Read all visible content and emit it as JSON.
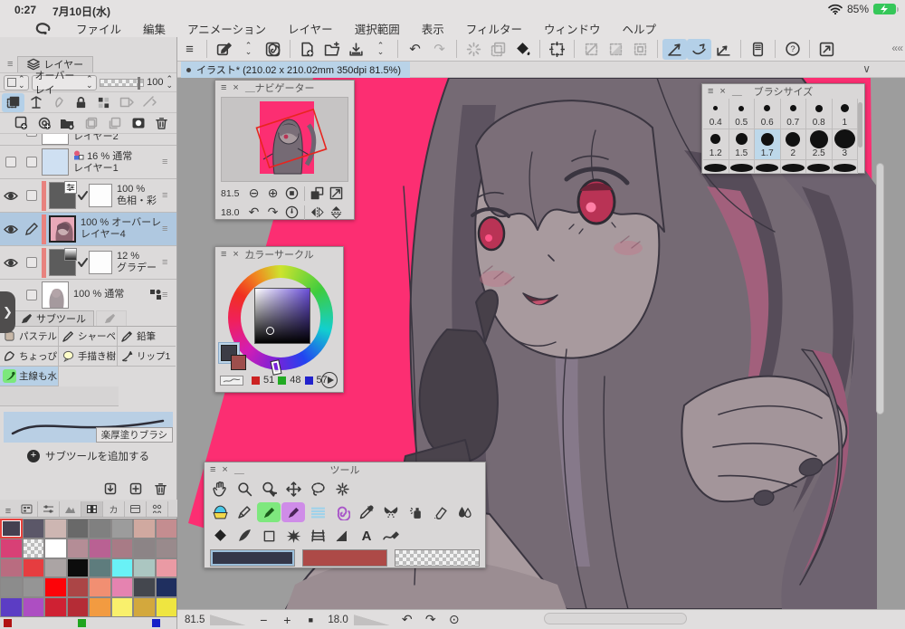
{
  "colors": {
    "accent_pink": "#fc2e72",
    "chrome": "#e4e2e2",
    "panel": "#d9d7d7",
    "highlight_blue": "#b9d3e8",
    "selected_row": "#afc8e0"
  },
  "status_bar": {
    "time": "0:27",
    "date": "7月10日(水)",
    "battery_percent": "85%"
  },
  "menu_bar": {
    "items": [
      "ファイル",
      "編集",
      "アニメーション",
      "レイヤー",
      "選択範囲",
      "表示",
      "フィルター",
      "ウィンドウ",
      "ヘルプ"
    ]
  },
  "document_tab": {
    "title": "イラスト* (210.02 x 210.02mm 350dpi 81.5%)"
  },
  "layers_panel": {
    "title": "レイヤー",
    "blend_mode": "オーバーレイ",
    "opacity_value": "100",
    "layers": [
      {
        "name": "レイヤー2"
      },
      {
        "opacity": "16 %",
        "mode": "通常",
        "name": "レイヤー1"
      },
      {
        "opacity": "100 %",
        "mode": "色相・彩"
      },
      {
        "opacity": "100 %",
        "mode": "オーバーレイ",
        "name": "レイヤー4"
      },
      {
        "opacity": "12 %",
        "name": "グラデー"
      },
      {
        "opacity": "100 %",
        "mode": "通常"
      }
    ]
  },
  "subtool_panel": {
    "title": "サブツール",
    "items": [
      "パステル",
      "シャーペ",
      "鉛筆",
      "ちょっぴ",
      "手描き樹",
      "リップ1",
      "主線も水"
    ],
    "preview_label": "楽厚塗りブラシ",
    "add_button": "サブツールを追加する"
  },
  "navigator": {
    "title": "ナビゲーター",
    "zoom": "81.5",
    "rotation": "18.0"
  },
  "brush_size_panel": {
    "title": "ブラシサイズ",
    "sizes": [
      "0.4",
      "0.5",
      "0.6",
      "0.7",
      "0.8",
      "1",
      "1.2",
      "1.5",
      "1.7",
      "2",
      "2.5",
      "3"
    ],
    "selected": "1.7"
  },
  "color_circle": {
    "title": "カラーサークル",
    "r": "51",
    "g": "48",
    "b": "57"
  },
  "tool_panel": {
    "title": "ツール"
  },
  "canvas_bar": {
    "zoom": "81.5",
    "rotation": "18.0"
  },
  "swatches": {
    "tab_label_ka": "カ",
    "colors": [
      "#454050",
      "#5b5768",
      "#cdb6b2",
      "#696969",
      "#808080",
      "#9c9c9c",
      "#d0a9a0",
      "#c48d90",
      "#d84076",
      "checker",
      "#ffffff",
      "#b48d96",
      "#b96193",
      "#a87b86",
      "#8c8486",
      "#998a8c",
      "#b96c80",
      "#e63d40",
      "#aba4a4",
      "#0c0c0c",
      "#5e7c7d",
      "#69f1f6",
      "#abc6c1",
      "#ea9aa4",
      "#8c8c8c",
      "#959595",
      "#fd0308",
      "#ab4546",
      "#f18f72",
      "#e583b0",
      "#44474e",
      "#1f2f5f",
      "#5c3dc4",
      "#ad4ec2",
      "#cf2133",
      "#b52c36",
      "#f29b41",
      "#f9f06c",
      "#d3a83d",
      "#efe540"
    ],
    "partial": [
      "#b11212",
      "#1fa51f",
      "#1520c8"
    ]
  }
}
